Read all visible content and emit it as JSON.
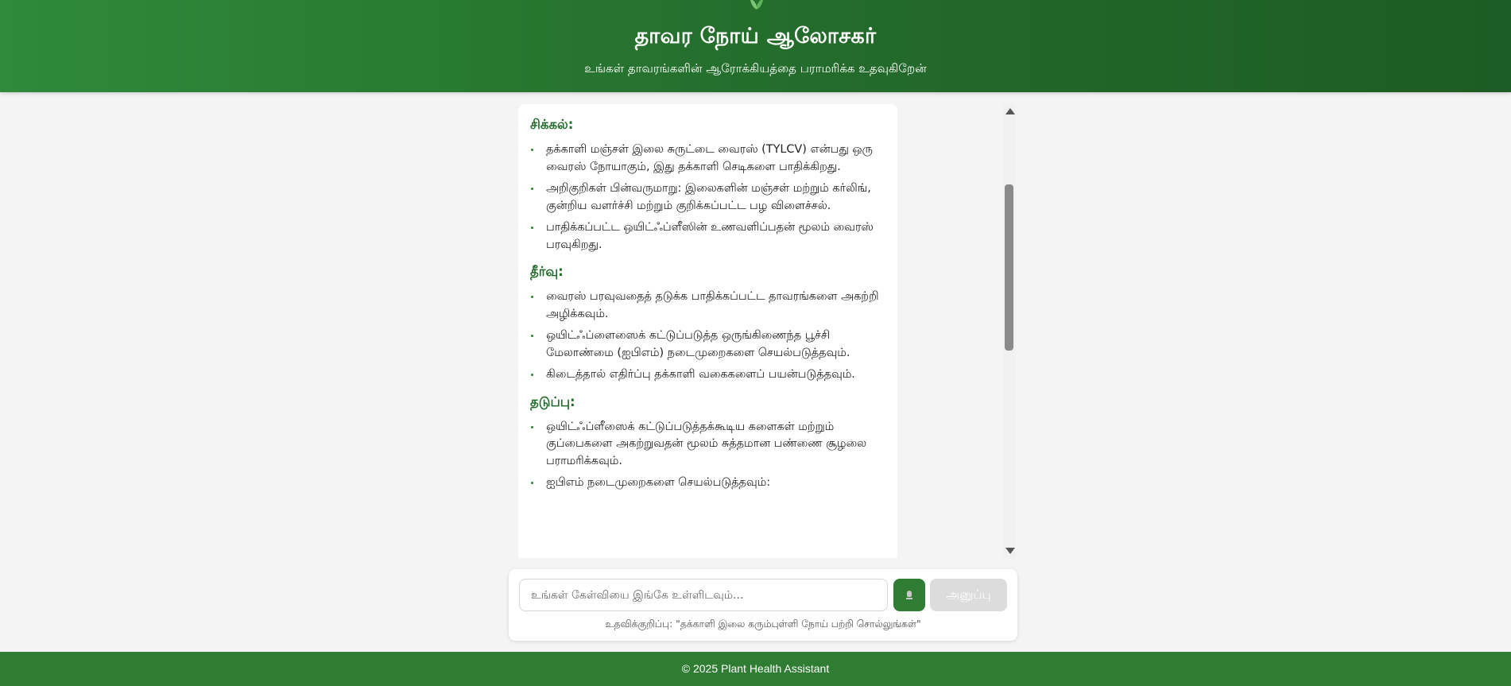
{
  "header": {
    "title": "தாவர நோய் ஆலோசகர்",
    "subtitle": "உங்கள் தாவரங்களின் ஆரோக்கியத்தை பராமரிக்க உதவுகிறேன்",
    "logo_icon": "leaf-icon",
    "background_color": "#2e7d32"
  },
  "message": {
    "sections": [
      {
        "heading": "சிக்கல்:",
        "items": [
          "தக்காளி மஞ்சள் இலை சுருட்டை வைரஸ் (TYLCV) என்பது ஒரு வைரஸ் நோயாகும், இது தக்காளி செடிகளை பாதிக்கிறது.",
          "அறிகுறிகள் பின்வருமாறு: இலைகளின் மஞ்சள் மற்றும் கர்லிங், குன்றிய வளர்ச்சி மற்றும் குறிக்கப்பட்ட பழ விளைச்சல்.",
          "பாதிக்கப்பட்ட ஒயிட்ஃப்ளீஸின் உணவளிப்பதன் மூலம் வைரஸ் பரவுகிறது."
        ]
      },
      {
        "heading": "தீர்வு:",
        "items": [
          "வைரஸ் பரவுவதைத் தடுக்க பாதிக்கப்பட்ட தாவரங்களை அகற்றி அழிக்கவும்.",
          "ஒயிட்ஃப்ளைஸைக் கட்டுப்படுத்த ஒருங்கிணைந்த பூச்சி மேலாண்மை (ஐபிஎம்) நடைமுறைகளை செயல்படுத்தவும்.",
          "கிடைத்தால் எதிர்ப்பு தக்காளி வகைகளைப் பயன்படுத்தவும்."
        ]
      },
      {
        "heading": "தடுப்பு:",
        "items": [
          "ஒயிட்ஃப்ளீஸைக் கட்டுப்படுத்தக்கூடிய களைகள் மற்றும் குப்பைகளை அகற்றுவதன் மூலம் சுத்தமான பண்ணை சூழலை பராமரிக்கவும்.",
          "ஐபிஎம் நடைமுறைகளை செயல்படுத்தவும்:"
        ]
      }
    ]
  },
  "input": {
    "placeholder": "உங்கள் கேள்வியை இங்கே உள்ளிடவும்...",
    "value": "",
    "mic_icon": "microphone-icon",
    "send_label": "அனுப்பு",
    "hint": "உதவிக்குறிப்பு: \"தக்காளி இலை கரும்புள்ளி நோய் பற்றி சொல்லுங்கள்\""
  },
  "footer": {
    "text": "© 2025 Plant Health Assistant"
  },
  "colors": {
    "primary": "#2e7d32",
    "heading_green": "#236b2b",
    "page_background": "#f4f4f4"
  }
}
